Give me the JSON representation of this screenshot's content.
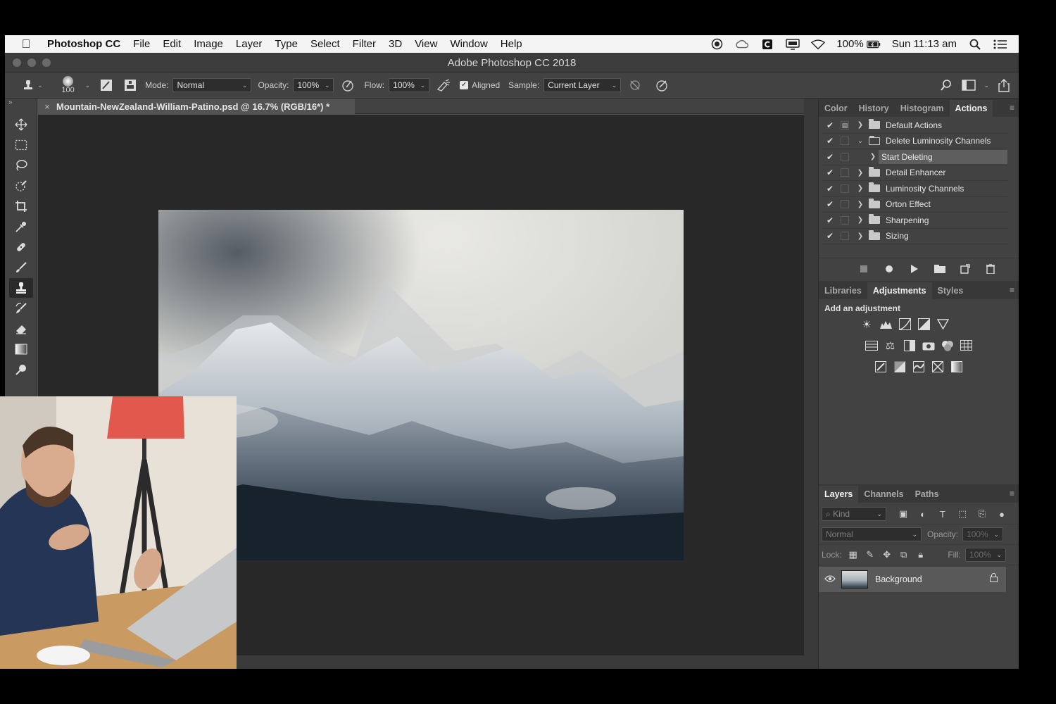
{
  "menubar": {
    "apple": "",
    "app_name": "Photoshop CC",
    "menus": [
      "File",
      "Edit",
      "Image",
      "Layer",
      "Type",
      "Select",
      "Filter",
      "3D",
      "View",
      "Window",
      "Help"
    ],
    "battery": "100%",
    "clock": "Sun 11:13 am",
    "icons": [
      "record-icon",
      "creative-cloud-icon",
      "c-app-icon",
      "display-icon",
      "wifi-icon",
      "battery-icon",
      "spotlight-search-icon",
      "notification-list-icon"
    ]
  },
  "window": {
    "title": "Adobe Photoshop CC 2018"
  },
  "options_bar": {
    "brush_size": "100",
    "mode_label": "Mode:",
    "mode_value": "Normal",
    "opacity_label": "Opacity:",
    "opacity_value": "100%",
    "flow_label": "Flow:",
    "flow_value": "100%",
    "aligned_label": "Aligned",
    "aligned_checked": true,
    "sample_label": "Sample:",
    "sample_value": "Current Layer"
  },
  "tools": [
    "move",
    "marquee",
    "lasso",
    "quick-selection",
    "crop",
    "eyedropper",
    "healing-brush",
    "brush",
    "clone-stamp",
    "history-brush",
    "eraser",
    "gradient",
    "dodge"
  ],
  "document": {
    "tab_title": "Mountain-NewZealand-William-Patino.psd @ 16.7% (RGB/16*) *",
    "close": "×"
  },
  "panels": {
    "top_tabs": [
      "Color",
      "History",
      "Histogram",
      "Actions"
    ],
    "top_active": "Actions",
    "actions": [
      {
        "name": "Default Actions",
        "expanded": false,
        "type": "set",
        "dialog": true
      },
      {
        "name": "Delete Luminosity Channels",
        "expanded": true,
        "type": "set",
        "dialog": false
      },
      {
        "name": "Start Deleting",
        "expanded": false,
        "type": "action",
        "dialog": false,
        "selected": true
      },
      {
        "name": "Detail Enhancer",
        "expanded": false,
        "type": "set",
        "dialog": false
      },
      {
        "name": "Luminosity Channels",
        "expanded": false,
        "type": "set",
        "dialog": false
      },
      {
        "name": "Orton Effect",
        "expanded": false,
        "type": "set",
        "dialog": false
      },
      {
        "name": "Sharpening",
        "expanded": false,
        "type": "set",
        "dialog": false
      },
      {
        "name": "Sizing",
        "expanded": false,
        "type": "set",
        "dialog": false
      }
    ],
    "middle_tabs": [
      "Libraries",
      "Adjustments",
      "Styles"
    ],
    "middle_active": "Adjustments",
    "adjustments_heading": "Add an adjustment",
    "bottom_tabs": [
      "Layers",
      "Channels",
      "Paths"
    ],
    "bottom_active": "Layers",
    "layers": {
      "kind_placeholder": "Kind",
      "blend_mode": "Normal",
      "opacity_label": "Opacity:",
      "opacity_value": "100%",
      "lock_label": "Lock:",
      "fill_label": "Fill:",
      "fill_value": "100%",
      "items": [
        {
          "name": "Background",
          "visible": true,
          "locked": true
        }
      ]
    }
  }
}
